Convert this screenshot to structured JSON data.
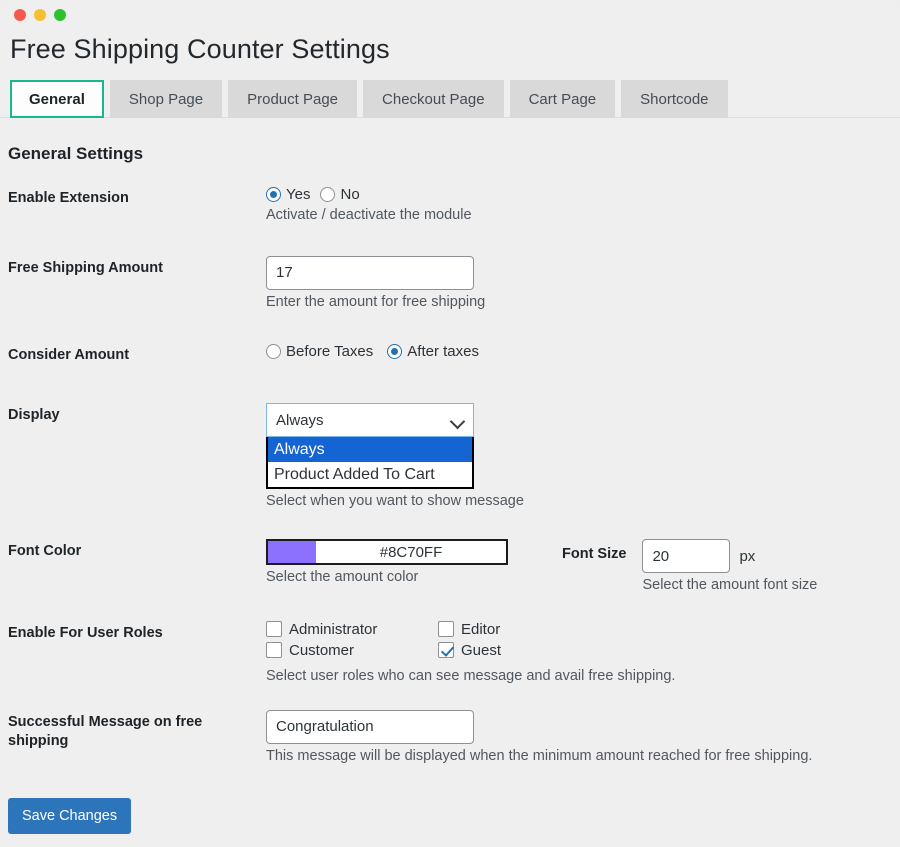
{
  "window": {
    "controls": [
      "close",
      "minimize",
      "maximize"
    ]
  },
  "header": {
    "title": "Free Shipping Counter Settings"
  },
  "tabs": [
    {
      "label": "General",
      "active": true
    },
    {
      "label": "Shop Page",
      "active": false
    },
    {
      "label": "Product Page",
      "active": false
    },
    {
      "label": "Checkout Page",
      "active": false
    },
    {
      "label": "Cart Page",
      "active": false
    },
    {
      "label": "Shortcode",
      "active": false
    }
  ],
  "section": {
    "title": "General Settings"
  },
  "fields": {
    "enable_extension": {
      "label": "Enable Extension",
      "options": [
        {
          "label": "Yes",
          "checked": true
        },
        {
          "label": "No",
          "checked": false
        }
      ],
      "hint": "Activate / deactivate the module"
    },
    "free_shipping_amount": {
      "label": "Free Shipping Amount",
      "value": "17",
      "placeholder": "",
      "hint": "Enter the amount for free shipping"
    },
    "consider_amount": {
      "label": "Consider Amount",
      "options": [
        {
          "label": "Before Taxes",
          "checked": false
        },
        {
          "label": "After taxes",
          "checked": true
        }
      ]
    },
    "display": {
      "label": "Display",
      "value": "Always",
      "expanded": true,
      "options": [
        {
          "label": "Always",
          "selected": true
        },
        {
          "label": "Product Added To Cart",
          "selected": false
        }
      ],
      "hint": "Select when you want to show message"
    },
    "font_color": {
      "label": "Font Color",
      "value": "#8C70FF",
      "swatch": "#8C70FF",
      "hint": "Select the amount color"
    },
    "font_size": {
      "label": "Font Size",
      "value": "20",
      "unit": "px",
      "hint": "Select the amount font size"
    },
    "user_roles": {
      "label": "Enable For User Roles",
      "options": [
        {
          "label": "Administrator",
          "checked": false
        },
        {
          "label": "Editor",
          "checked": false
        },
        {
          "label": "Customer",
          "checked": false
        },
        {
          "label": "Guest",
          "checked": true
        }
      ],
      "hint": "Select user roles who can see message and avail free shipping."
    },
    "success_message": {
      "label": "Successful Message on free shipping",
      "value": "Congratulation",
      "placeholder": "",
      "hint": "This message will be displayed when the minimum amount reached for free shipping."
    }
  },
  "actions": {
    "save_label": "Save Changes"
  },
  "colors": {
    "accent_tab": "#17b890",
    "primary_button": "#2d75bb",
    "radio_blue": "#2271b1",
    "dropdown_highlight": "#1464d4",
    "font_color_swatch": "#8C70FF",
    "page_background": "#efefef"
  }
}
